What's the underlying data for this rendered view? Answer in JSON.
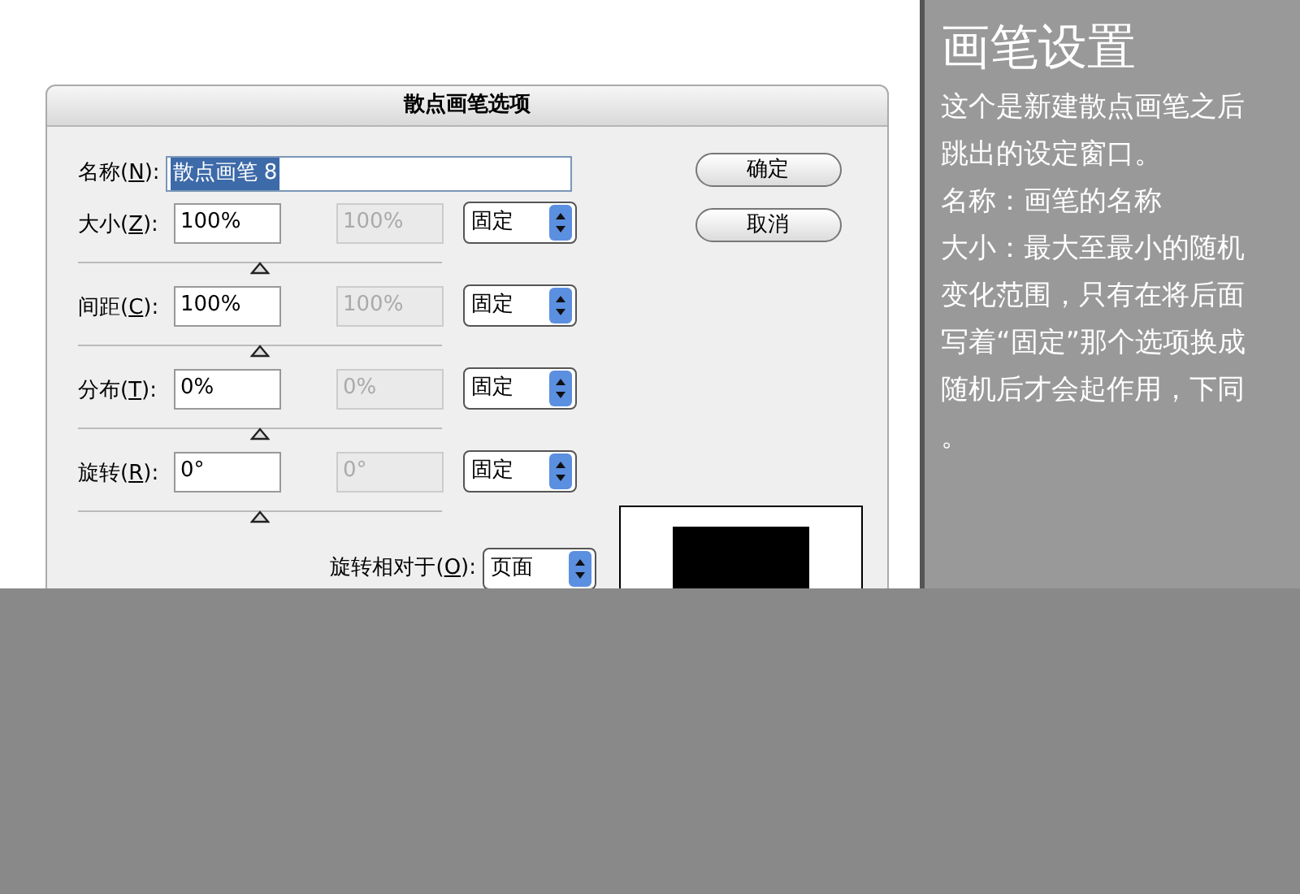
{
  "dialog": {
    "title": "散点画笔选项",
    "name_field": {
      "label_parts": [
        "名称(",
        "N",
        "):"
      ],
      "value": "散点画笔 8",
      "highlighted": true
    },
    "rows": [
      {
        "label_parts": [
          "大小(",
          "Z",
          "):"
        ],
        "value": "100%",
        "second_value": "100%",
        "dropdown": "固定",
        "level": 0.5
      },
      {
        "label_parts": [
          "间距(",
          "C",
          "):"
        ],
        "value": "100%",
        "second_value": "100%",
        "dropdown": "固定",
        "level": 0.5
      },
      {
        "label_parts": [
          "分布(",
          "T",
          "):"
        ],
        "value": "0%",
        "second_value": "0%",
        "dropdown": "固定",
        "level": 0.5
      },
      {
        "label_parts": [
          "旋转(",
          "R",
          "):"
        ],
        "value": "0°",
        "second_value": "0°",
        "dropdown": "固定",
        "level": 0.5
      }
    ],
    "rotation_relative": {
      "label_parts": [
        "旋转相对于(",
        "O",
        "):"
      ],
      "dropdown": "页面"
    },
    "buttons": [
      "确定",
      "取消"
    ]
  },
  "notes": {
    "title": "画笔设置",
    "lines": [
      "这个是新建散点画笔之后",
      "跳出的设定窗口。",
      "名称：画笔的名称",
      "大小：最大至最小的随机",
      "变化范围，只有在将后面",
      "写着“固定”那个选项换成",
      "随机后才会起作用，下同",
      "。"
    ]
  }
}
